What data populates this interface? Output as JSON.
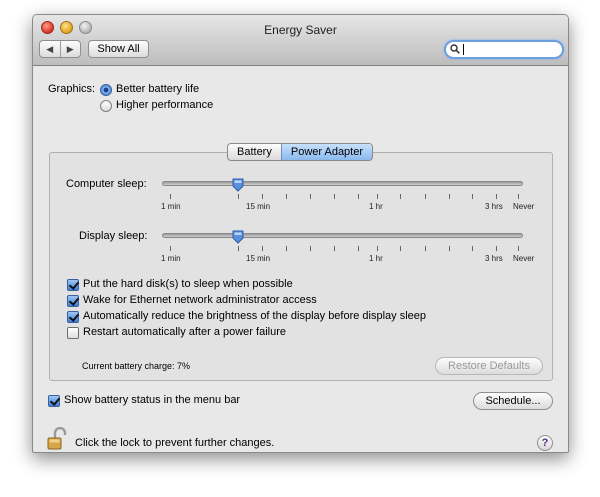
{
  "window": {
    "title": "Energy Saver"
  },
  "toolbar": {
    "back_glyph": "◀",
    "forward_glyph": "▶",
    "show_all_label": "Show All",
    "search_placeholder": "",
    "search_value": ""
  },
  "graphics": {
    "label": "Graphics:",
    "options": [
      {
        "label": "Better battery life",
        "selected": true
      },
      {
        "label": "Higher performance",
        "selected": false
      }
    ]
  },
  "tabs": [
    {
      "label": "Battery",
      "active": false
    },
    {
      "label": "Power Adapter",
      "active": true
    }
  ],
  "sliders": [
    {
      "label": "Computer sleep:",
      "value": "15 min"
    },
    {
      "label": "Display sleep:",
      "value": "15 min"
    }
  ],
  "tick_labels": [
    "1 min",
    "15 min",
    "1 hr",
    "3 hrs",
    "Never"
  ],
  "checkboxes": [
    {
      "label": "Put the hard disk(s) to sleep when possible",
      "checked": true
    },
    {
      "label": "Wake for Ethernet network administrator access",
      "checked": true
    },
    {
      "label": "Automatically reduce the brightness of the display before display sleep",
      "checked": true
    },
    {
      "label": "Restart automatically after a power failure",
      "checked": false
    }
  ],
  "battery_charge": "Current battery charge: 7%",
  "restore_defaults_label": "Restore Defaults",
  "show_status": {
    "label": "Show battery status in the menu bar",
    "checked": true
  },
  "schedule_label": "Schedule...",
  "lock_text": "Click the lock to prevent further changes.",
  "help_label": "?",
  "colors": {
    "accent": "#3c78d0",
    "selected_tab": "#8ab9ef"
  }
}
